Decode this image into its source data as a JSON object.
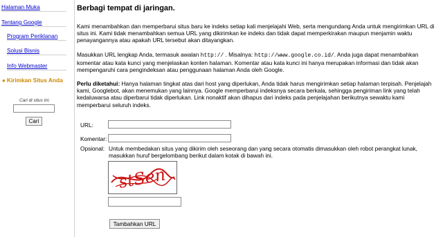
{
  "sidebar": {
    "items": [
      {
        "label": "Halaman Muka"
      },
      {
        "label": "Tentang Google"
      },
      {
        "label": "Program Periklanan"
      },
      {
        "label": "Solusi Bisnis"
      },
      {
        "label": "Info Webmaster"
      },
      {
        "label": "Kirimkan Situs Anda"
      }
    ],
    "search": {
      "label": "Cari di situs ini:",
      "value": "",
      "button_label": "Cari"
    }
  },
  "main": {
    "title": "Berbagi tempat di jaringan.",
    "intro": "Kami menambahkan dan memperbarui situs baru ke indeks setiap kali menjelajahi Web, serta mengundang Anda untuk mengirimkan URL di situs ini. Kami tidak menambahkan semua URL yang dikirimkan ke indeks dan tidak dapat memperkirakan maupun menjamin waktu penayangannya atau apakah URL tersebut akan ditayangkan.",
    "instructions": {
      "part1": "Masukkan URL lengkap Anda, termasuk awalan ",
      "code1": "http://",
      "part2": " . Misalnya: ",
      "code2": "http://www.google.co.id/",
      "part3": ". Anda juga dapat menambahkan komentar atau kata kunci yang menjelaskan konten halaman. Komentar atau kata kunci ini hanya merupakan informasi dan tidak akan mempengaruhi cara pengindeksan atau penggunaan halaman Anda oleh Google."
    },
    "notice": {
      "heading": "Perlu diketahui:",
      "text": " Hanya halaman tingkat atas dari host yang diperlukan, Anda tidak harus mengirimkan setiap halaman terpisah. Penjelajah kami, Googlebot, akan menemukan yang lainnya. Google memperbarui indeksnya secara berkala, sehingga pengiriman link yang telah kedaluwarsa atau diperbarui tidak diperlukan. Link nonaktif akan dihapus dari indeks pada penjelajahan berikutnya sewaktu kami memperbarui seluruh indeks."
    },
    "form": {
      "url_label": "URL:",
      "url_value": "",
      "comment_label": "Komentar:",
      "comment_value": "",
      "optional_label": "Opsional:",
      "optional_note": "Untuk membedakan situs yang dikirim oleh seseorang dan yang secara otomatis dimasukkan oleh robot perangkat lunak, masukkan huruf bergelombang berikut dalam kotak di bawah ini.",
      "captcha_text": "stSen",
      "captcha_value": "",
      "submit_label": "Tambahkan URL"
    }
  },
  "colors": {
    "link": "#0000cc",
    "active": "#cc8800",
    "captcha": "#cc1111"
  }
}
